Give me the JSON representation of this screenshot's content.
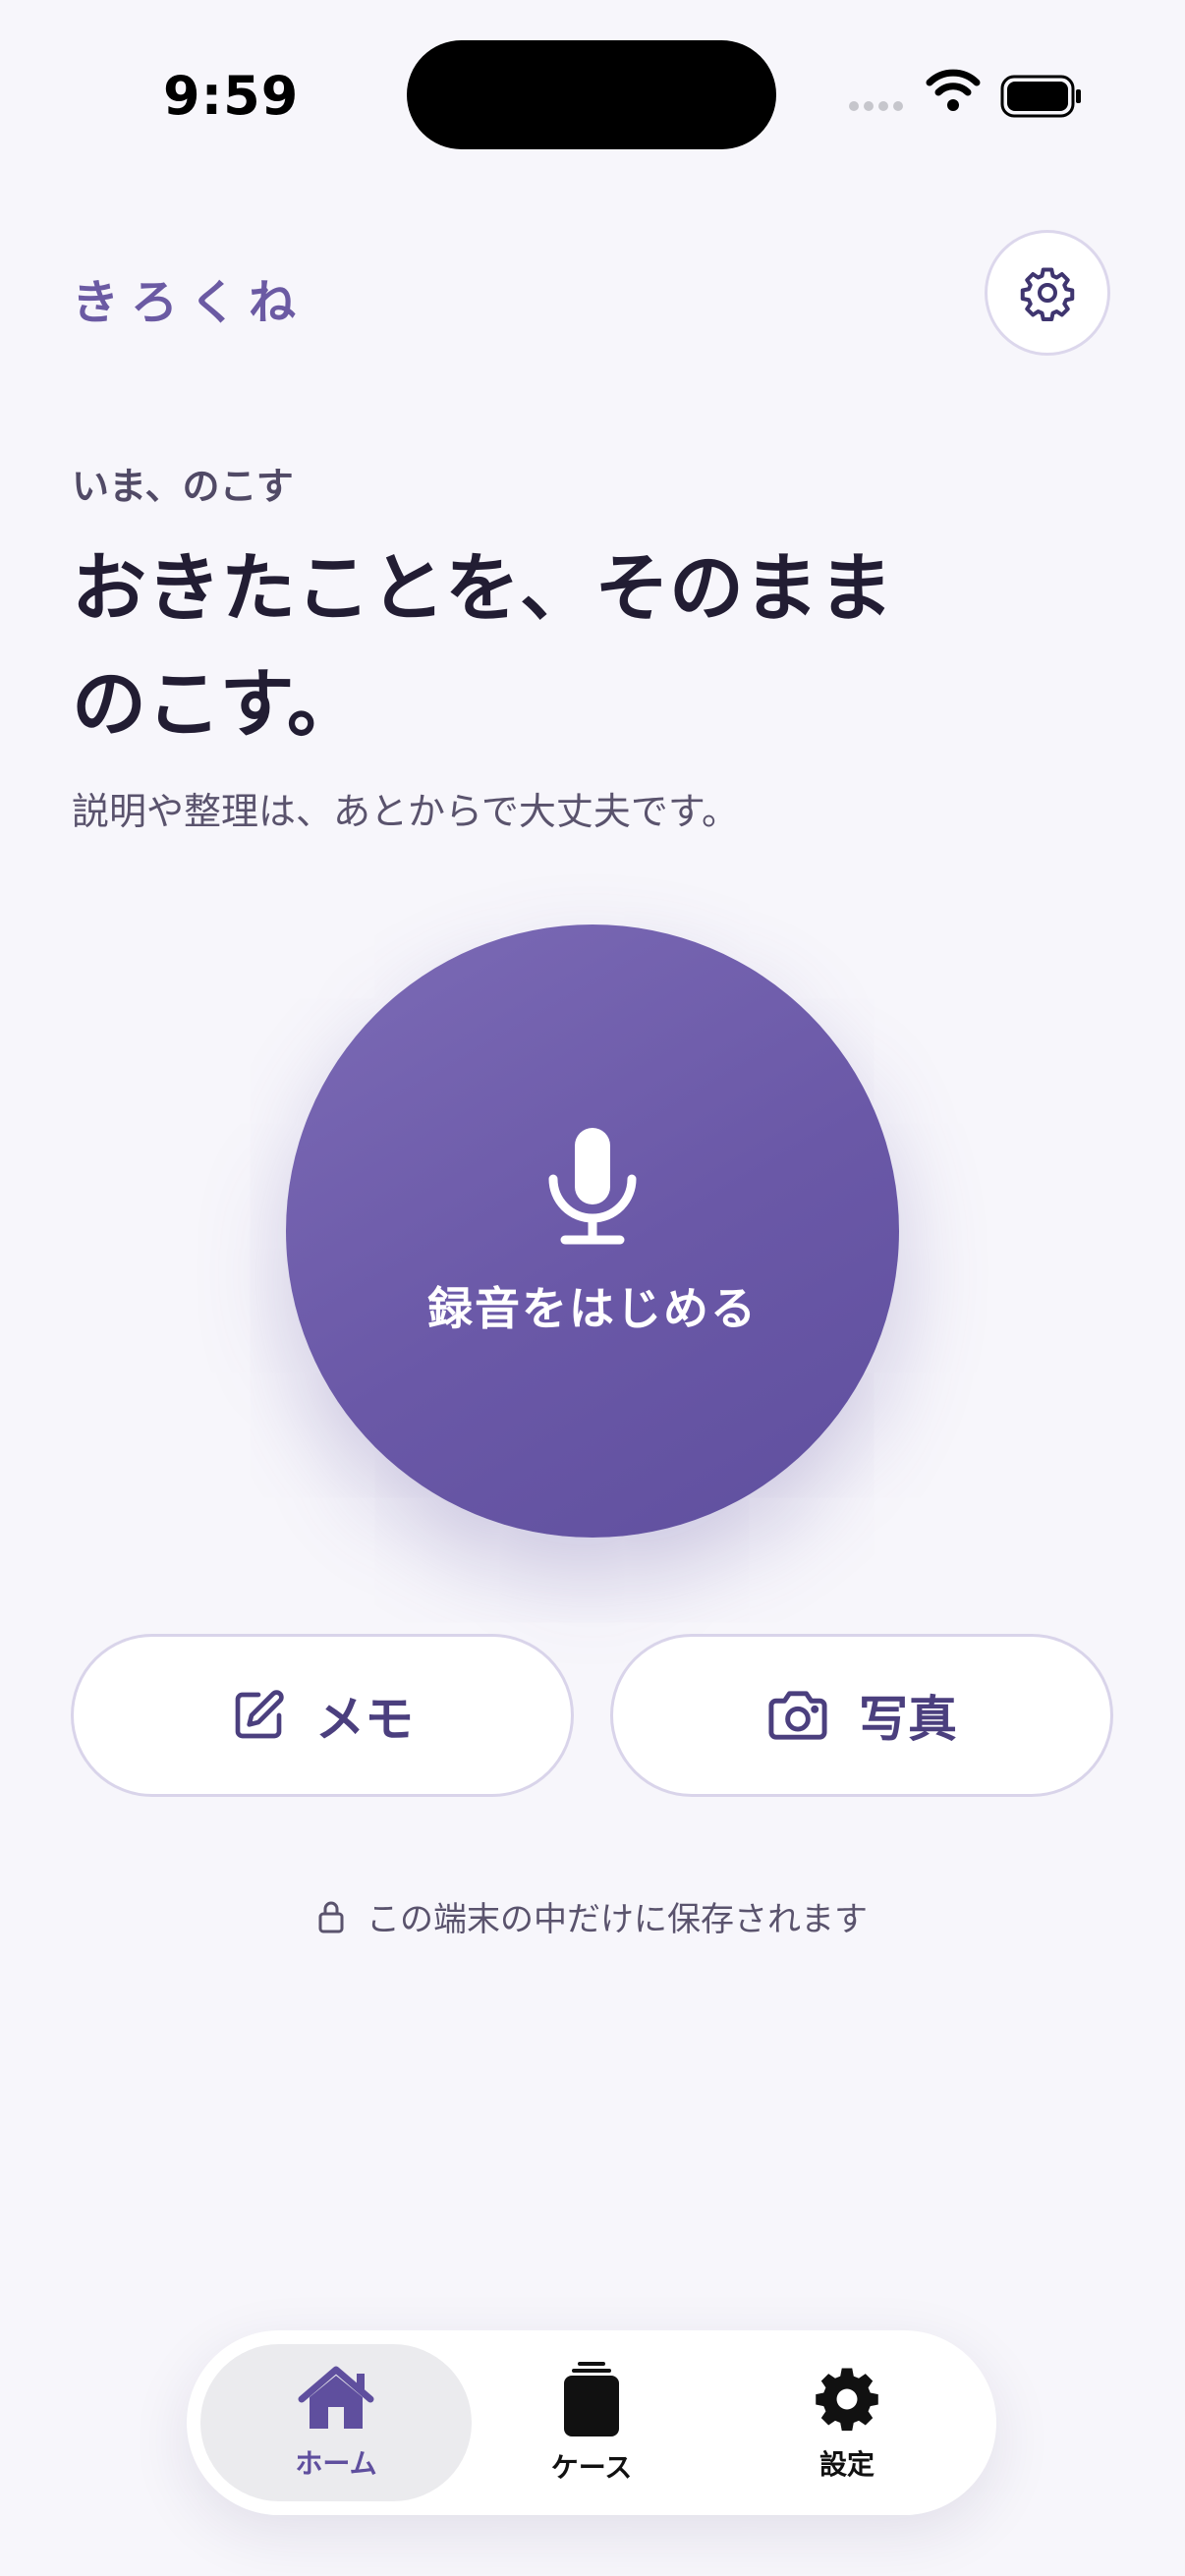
{
  "status_bar": {
    "time": "9:59"
  },
  "header": {
    "brand": "きろくね"
  },
  "hero": {
    "eyebrow": "いま、のこす",
    "headline_line1": "おきたことを、そのまま",
    "headline_line2": "のこす。",
    "subtext": "説明や整理は、あとからで大丈夫です。"
  },
  "record": {
    "label": "録音をはじめる"
  },
  "actions": {
    "memo": "メモ",
    "photo": "写真"
  },
  "privacy": {
    "text": "この端末の中だけに保存されます"
  },
  "tabs": [
    {
      "label": "ホーム",
      "icon": "home-icon",
      "active": true
    },
    {
      "label": "ケース",
      "icon": "stack-icon",
      "active": false
    },
    {
      "label": "設定",
      "icon": "gear-icon",
      "active": false
    }
  ],
  "colors": {
    "accent": "#6a58a7",
    "background": "#f7f6fb",
    "text": "#221d33"
  }
}
